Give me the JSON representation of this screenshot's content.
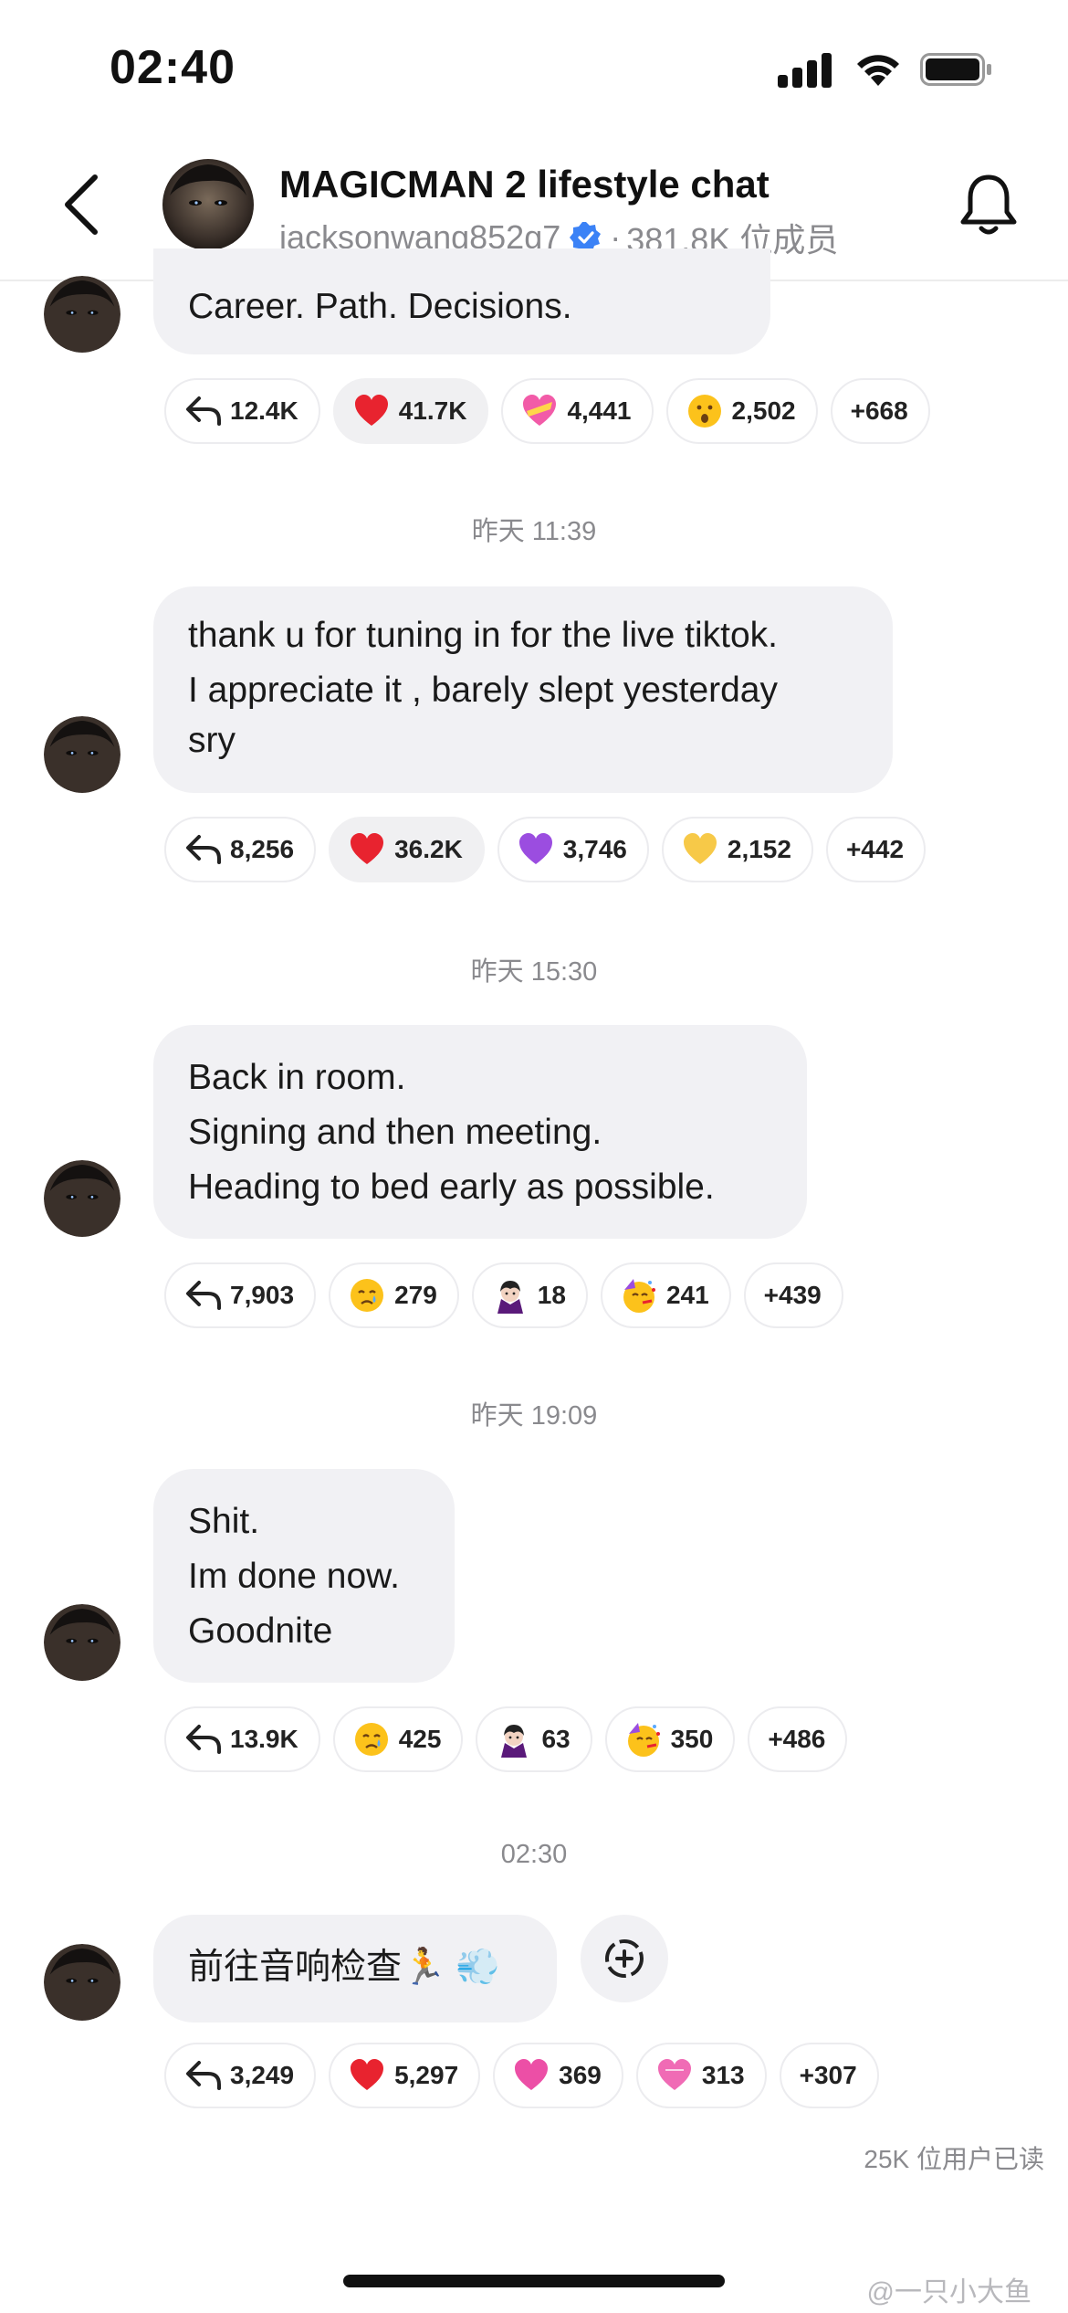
{
  "status_bar": {
    "time": "02:40"
  },
  "header": {
    "title": "MAGICMAN 2 lifestyle chat",
    "handle": "jacksonwang852g7",
    "separator": "·",
    "members": "381.8K 位成员"
  },
  "messages": [
    {
      "timestamp": "",
      "lines": [
        "Career. Path. Decisions."
      ],
      "reactions": [
        {
          "icon": "reply-icon",
          "count": "12.4K",
          "active": false
        },
        {
          "icon": "red-heart-emoji",
          "count": "41.7K",
          "active": true
        },
        {
          "icon": "heart-ribbon-emoji",
          "count": "4,441",
          "active": false
        },
        {
          "icon": "surprised-face-emoji",
          "count": "2,502",
          "active": false
        },
        {
          "icon": "",
          "count": "+668",
          "active": false
        }
      ]
    },
    {
      "timestamp": "昨天 11:39",
      "lines": [
        "thank u for tuning in for the live tiktok.",
        "I appreciate it , barely slept yesterday",
        "sry"
      ],
      "reactions": [
        {
          "icon": "reply-icon",
          "count": "8,256",
          "active": false
        },
        {
          "icon": "red-heart-emoji",
          "count": "36.2K",
          "active": true
        },
        {
          "icon": "purple-heart-emoji",
          "count": "3,746",
          "active": false
        },
        {
          "icon": "yellow-heart-emoji",
          "count": "2,152",
          "active": false
        },
        {
          "icon": "",
          "count": "+442",
          "active": false
        }
      ]
    },
    {
      "timestamp": "昨天 15:30",
      "lines": [
        "Back in room.",
        "Signing and then meeting.",
        "Heading to bed early as possible."
      ],
      "reactions": [
        {
          "icon": "reply-icon",
          "count": "7,903",
          "active": false
        },
        {
          "icon": "crying-face-emoji",
          "count": "279",
          "active": false
        },
        {
          "icon": "vampire-emoji",
          "count": "18",
          "active": false
        },
        {
          "icon": "party-face-emoji",
          "count": "241",
          "active": false
        },
        {
          "icon": "",
          "count": "+439",
          "active": false
        }
      ]
    },
    {
      "timestamp": "昨天 19:09",
      "lines": [
        "Shit.",
        "Im done now.",
        "Goodnite"
      ],
      "reactions": [
        {
          "icon": "reply-icon",
          "count": "13.9K",
          "active": false
        },
        {
          "icon": "crying-face-emoji",
          "count": "425",
          "active": false
        },
        {
          "icon": "vampire-emoji",
          "count": "63",
          "active": false
        },
        {
          "icon": "party-face-emoji",
          "count": "350",
          "active": false
        },
        {
          "icon": "",
          "count": "+486",
          "active": false
        }
      ]
    },
    {
      "timestamp": "02:30",
      "lines": [
        "前往音响检查🏃 💨"
      ],
      "reactions": [
        {
          "icon": "reply-icon",
          "count": "3,249",
          "active": false
        },
        {
          "icon": "red-heart-emoji",
          "count": "5,297",
          "active": false
        },
        {
          "icon": "pink-heart-emoji",
          "count": "369",
          "active": false
        },
        {
          "icon": "heart-ribbon-emoji",
          "count": "313",
          "active": false
        },
        {
          "icon": "",
          "count": "+307",
          "active": false
        }
      ]
    }
  ],
  "read_receipt": "25K 位用户已读",
  "watermark": "@一只小大鱼",
  "colors": {
    "bubble": "#f1f1f4",
    "muted_text": "#8a8a8e",
    "verified_blue": "#3b82f6",
    "red_heart": "#e8232f",
    "purple_heart": "#9b4de0",
    "yellow_heart": "#f7c948",
    "pink_heart": "#ec4fa6"
  }
}
